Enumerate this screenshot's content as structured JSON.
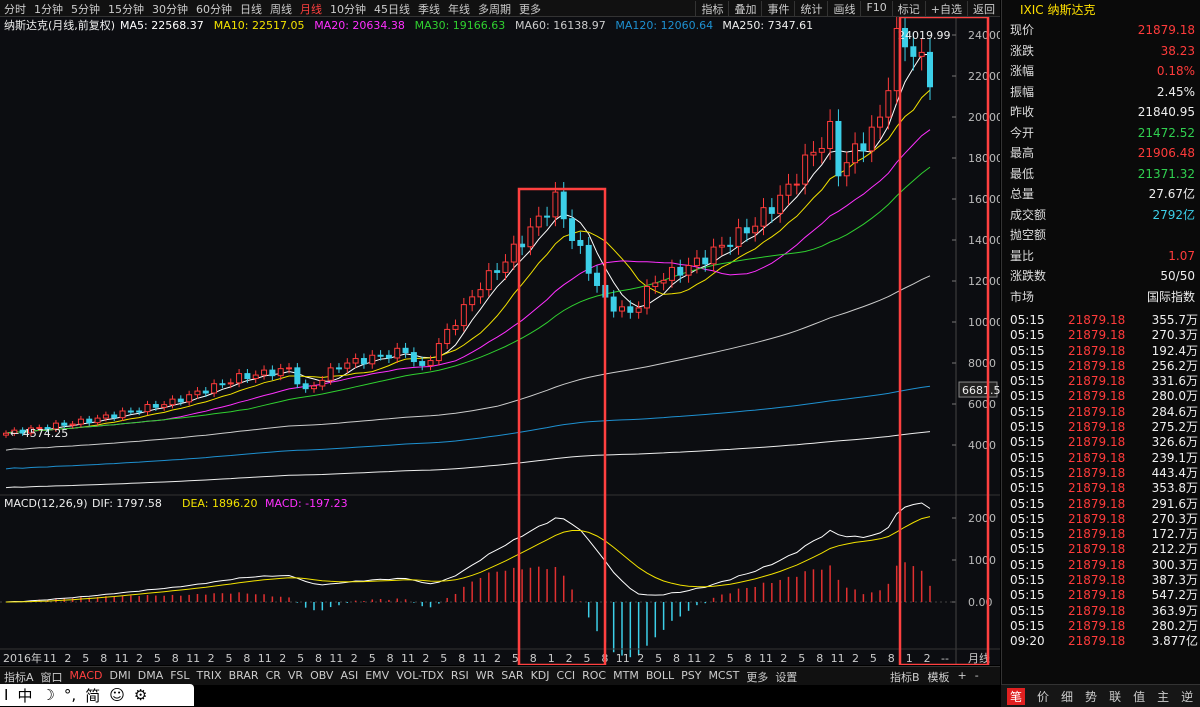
{
  "toolbar": {
    "periods": [
      "分时",
      "1分钟",
      "5分钟",
      "15分钟",
      "30分钟",
      "60分钟",
      "日线",
      "周线",
      "月线",
      "10分钟",
      "45日线",
      "季线",
      "年线",
      "多周期",
      "更多"
    ],
    "active_period": "月线",
    "tools": [
      "指标",
      "叠加",
      "事件",
      "统计",
      "画线",
      "F10",
      "标记",
      "+自选",
      "返回"
    ]
  },
  "main_chart": {
    "name": "纳斯达克(月线,前复权)",
    "ma": [
      {
        "label": "MA5: 22568.37",
        "color": "#ffffff"
      },
      {
        "label": "MA10: 22517.05",
        "color": "#f2e200"
      },
      {
        "label": "MA20: 20634.38",
        "color": "#ff30ff"
      },
      {
        "label": "MA30: 19166.63",
        "color": "#30d030"
      },
      {
        "label": "MA60: 16138.97",
        "color": "#cccccc"
      },
      {
        "label": "MA120: 12060.64",
        "color": "#1e90d0"
      },
      {
        "label": "MA250: 7347.61",
        "color": "#eeeeee"
      }
    ],
    "y_ticks": [
      "24000",
      "22000",
      "20000",
      "18000",
      "16000",
      "14000",
      "12000",
      "10000",
      "8000",
      "6000",
      "4000"
    ],
    "high_label": "24019.99",
    "low_label": "4574.25",
    "price_tag": "6681.5"
  },
  "macd_panel": {
    "title": "MACD(12,26,9)",
    "dif": "DIF: 1797.58",
    "dea": "DEA: 1896.20",
    "macd": "MACD: -197.23",
    "y_ticks": [
      "2000",
      "1000",
      "0.00"
    ]
  },
  "x_axis": {
    "year_label": "2016年",
    "labels": [
      "11",
      "2",
      "5",
      "8",
      "11",
      "2",
      "5",
      "8",
      "11",
      "2",
      "5",
      "8",
      "11",
      "2",
      "5",
      "8",
      "11",
      "2",
      "5",
      "8",
      "11",
      "2",
      "5",
      "8",
      "11",
      "2",
      "5",
      "8",
      "1",
      "2",
      "5",
      "8",
      "11",
      "2",
      "5",
      "8",
      "11",
      "2",
      "5",
      "8",
      "11",
      "2",
      "5",
      "8",
      "11",
      "2",
      "5",
      "8",
      "1",
      "2",
      "--"
    ],
    "period_label": "月线"
  },
  "indicator_tabs": [
    "指标A",
    "窗口",
    "MACD",
    "DMI",
    "DMA",
    "FSL",
    "TRIX",
    "BRAR",
    "CR",
    "VR",
    "OBV",
    "ASI",
    "EMV",
    "VOL-TDX",
    "RSI",
    "WR",
    "SAR",
    "KDJ",
    "CCI",
    "ROC",
    "MTM",
    "BOLL",
    "PSY",
    "MCST",
    "更多",
    "设置"
  ],
  "active_indicator": "MACD",
  "indicator_right": [
    "指标B",
    "模板",
    "+",
    "-"
  ],
  "quote": {
    "code": "IXIC",
    "name": "纳斯达克",
    "rows": [
      {
        "k": "现价",
        "v": "21879.18",
        "c": "red"
      },
      {
        "k": "涨跌",
        "v": "38.23",
        "c": "red"
      },
      {
        "k": "涨幅",
        "v": "0.18%",
        "c": "red"
      },
      {
        "k": "振幅",
        "v": "2.45%",
        "c": "white"
      },
      {
        "k": "昨收",
        "v": "21840.95",
        "c": "white"
      },
      {
        "k": "今开",
        "v": "21472.52",
        "c": "green"
      },
      {
        "k": "最高",
        "v": "21906.48",
        "c": "red"
      },
      {
        "k": "最低",
        "v": "21371.32",
        "c": "green"
      },
      {
        "k": "总量",
        "v": "27.67亿",
        "c": "white"
      },
      {
        "k": "成交额",
        "v": "2792亿",
        "c": "cyan"
      },
      {
        "k": "抛空额",
        "v": "",
        "c": "white"
      },
      {
        "k": "量比",
        "v": "1.07",
        "c": "red"
      },
      {
        "k": "涨跌数",
        "v": "50/50",
        "c": "white"
      },
      {
        "k": "市场",
        "v": "国际指数",
        "c": "white"
      }
    ]
  },
  "ticks": [
    {
      "t": "05:15",
      "p": "21879.18",
      "v": "355.7万"
    },
    {
      "t": "05:15",
      "p": "21879.18",
      "v": "270.3万"
    },
    {
      "t": "05:15",
      "p": "21879.18",
      "v": "192.4万"
    },
    {
      "t": "05:15",
      "p": "21879.18",
      "v": "256.2万"
    },
    {
      "t": "05:15",
      "p": "21879.18",
      "v": "331.6万"
    },
    {
      "t": "05:15",
      "p": "21879.18",
      "v": "280.0万"
    },
    {
      "t": "05:15",
      "p": "21879.18",
      "v": "284.6万"
    },
    {
      "t": "05:15",
      "p": "21879.18",
      "v": "275.2万"
    },
    {
      "t": "05:15",
      "p": "21879.18",
      "v": "326.6万"
    },
    {
      "t": "05:15",
      "p": "21879.18",
      "v": "239.1万"
    },
    {
      "t": "05:15",
      "p": "21879.18",
      "v": "443.4万"
    },
    {
      "t": "05:15",
      "p": "21879.18",
      "v": "353.8万"
    },
    {
      "t": "05:15",
      "p": "21879.18",
      "v": "291.6万"
    },
    {
      "t": "05:15",
      "p": "21879.18",
      "v": "270.3万"
    },
    {
      "t": "05:15",
      "p": "21879.18",
      "v": "172.7万"
    },
    {
      "t": "05:15",
      "p": "21879.18",
      "v": "212.2万"
    },
    {
      "t": "05:15",
      "p": "21879.18",
      "v": "300.3万"
    },
    {
      "t": "05:15",
      "p": "21879.18",
      "v": "387.3万"
    },
    {
      "t": "05:15",
      "p": "21879.18",
      "v": "547.2万"
    },
    {
      "t": "05:15",
      "p": "21879.18",
      "v": "363.9万"
    },
    {
      "t": "05:15",
      "p": "21879.18",
      "v": "280.2万"
    },
    {
      "t": "09:20",
      "p": "21879.18",
      "v": "3.877亿"
    }
  ],
  "side_bottom": [
    "笔",
    "价",
    "细",
    "势",
    "联",
    "值",
    "主",
    "逆",
    "筹"
  ],
  "ime": [
    "中",
    "☽",
    "°,",
    "简",
    "☺",
    "⚙"
  ],
  "colors": {
    "up": "#ff3b3b",
    "down": "#3ccfe8",
    "highlight": "#ff4040"
  }
}
